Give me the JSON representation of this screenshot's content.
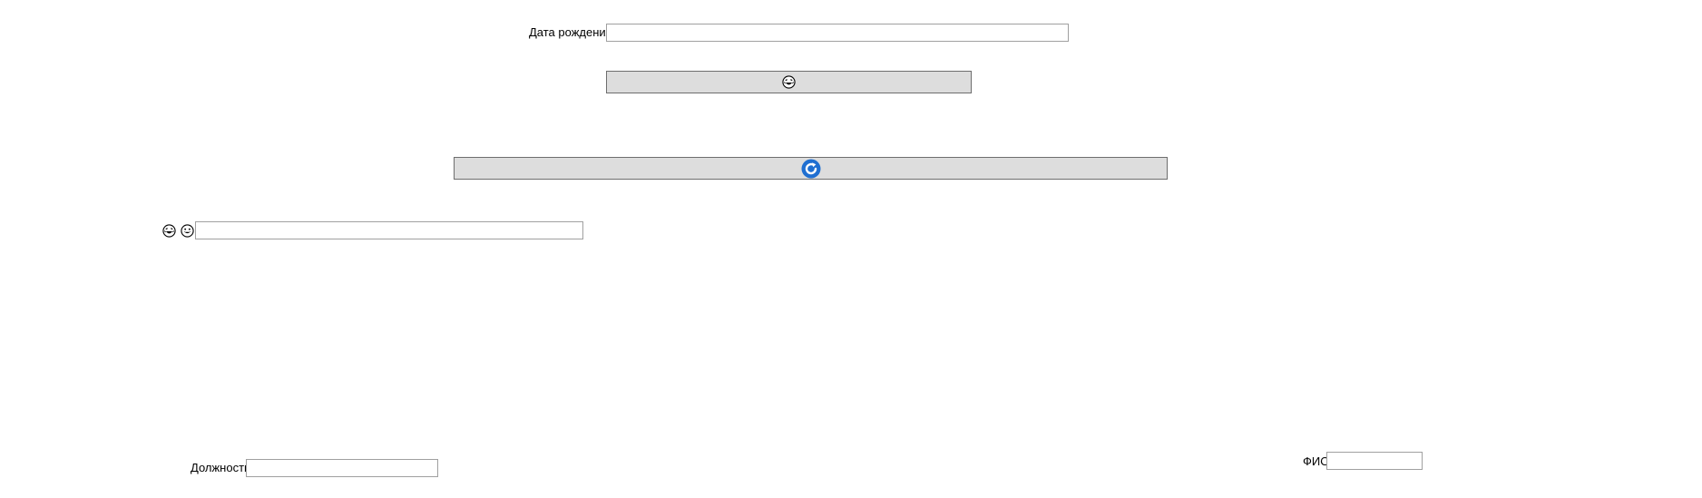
{
  "form": {
    "birth_date": {
      "label": "Дата рождения",
      "value": ""
    },
    "emoji_button": {
      "icon": "laughing-face-icon"
    },
    "refresh_button": {
      "icon": "refresh-icon",
      "accent_color": "#1f6fd1"
    },
    "emoji_field": {
      "icons": [
        "laughing-face-icon",
        "grinning-face-icon"
      ],
      "value": ""
    },
    "position": {
      "label": "Должность",
      "value": ""
    },
    "full_name": {
      "label": "ФИО",
      "value": ""
    }
  },
  "colors": {
    "button_bg": "#dddddd",
    "button_border": "#6e6e6e",
    "field_border": "#a0a0a0"
  }
}
